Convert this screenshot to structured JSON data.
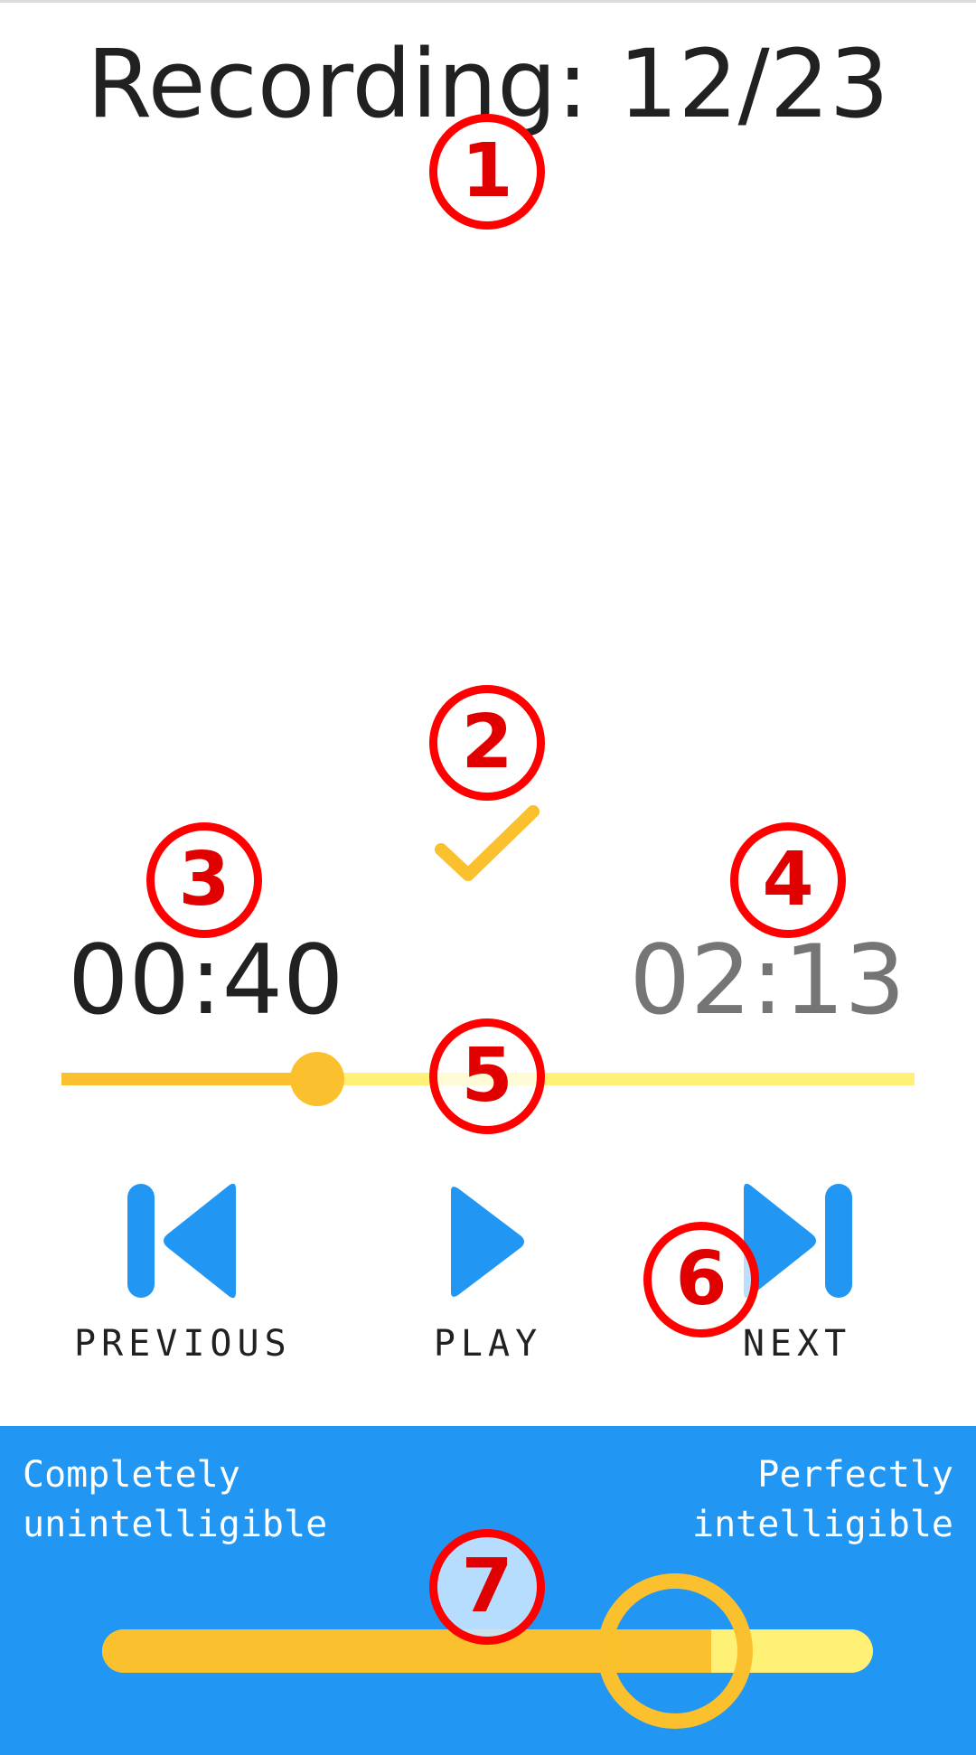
{
  "header": {
    "title": "Recording: 12/23"
  },
  "player": {
    "status_icon": "check-icon",
    "elapsed_time": "00:40",
    "total_time": "02:13",
    "progress_fraction": 0.3,
    "controls": [
      {
        "id": "previous",
        "label": "PREVIOUS",
        "icon": "skip-previous-icon"
      },
      {
        "id": "play",
        "label": "PLAY",
        "icon": "play-icon"
      },
      {
        "id": "next",
        "label": "NEXT",
        "icon": "skip-next-icon"
      }
    ]
  },
  "rating": {
    "min_label_line1": "Completely",
    "min_label_line2": "unintelligible",
    "max_label_line1": "Perfectly",
    "max_label_line2": "intelligible",
    "value_fraction": 0.79
  },
  "annotations": [
    "1",
    "2",
    "3",
    "4",
    "5",
    "6",
    "7"
  ],
  "colors": {
    "accent_blue": "#2196f3",
    "amber": "#fbc02d",
    "light_yellow": "#fff176",
    "annotation_red": "#ff0000"
  }
}
